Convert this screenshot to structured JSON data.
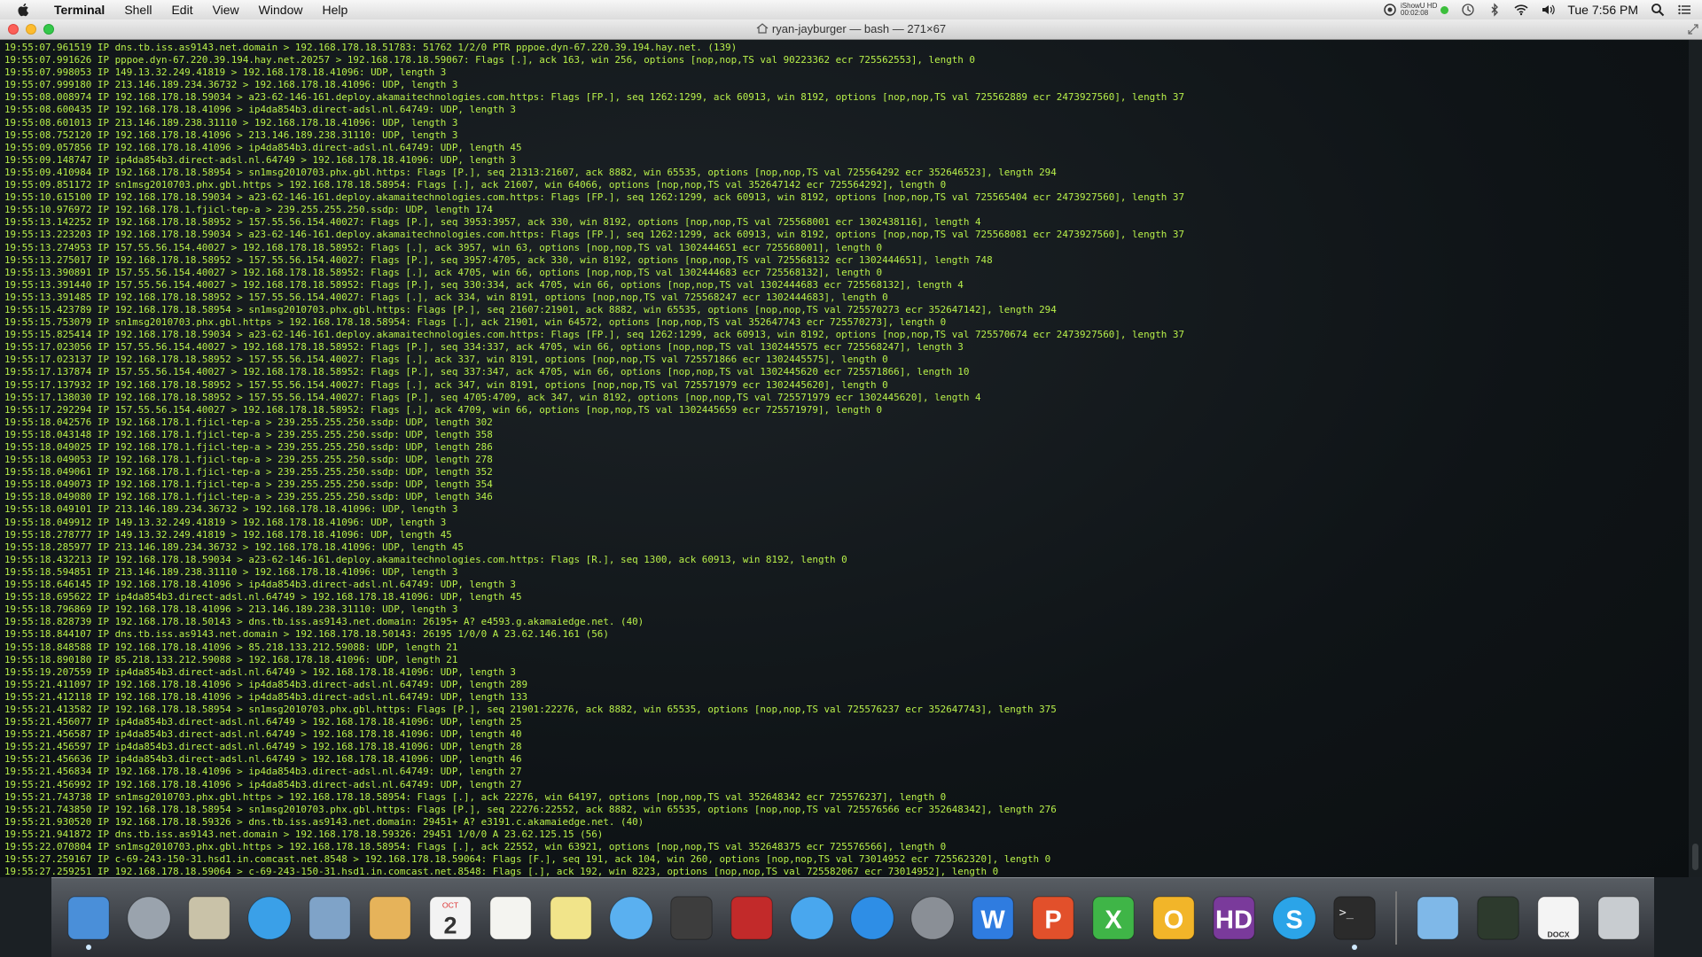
{
  "menubar": {
    "app": "Terminal",
    "items": [
      "Shell",
      "Edit",
      "View",
      "Window",
      "Help"
    ],
    "recorder_label": "iShowU HD",
    "recorder_time": "00:02:08",
    "clock": "Tue 7:56 PM"
  },
  "window": {
    "title": "ryan-jayburger — bash — 271×67"
  },
  "terminal": {
    "text_color": "#b8f04a",
    "lines": [
      "19:55:07.961519 IP dns.tb.iss.as9143.net.domain > 192.168.178.18.51783: 51762 1/2/0 PTR pppoe.dyn-67.220.39.194.hay.net. (139)",
      "19:55:07.991626 IP pppoe.dyn-67.220.39.194.hay.net.20257 > 192.168.178.18.59067: Flags [.], ack 163, win 256, options [nop,nop,TS val 90223362 ecr 725562553], length 0",
      "19:55:07.998053 IP 149.13.32.249.41819 > 192.168.178.18.41096: UDP, length 3",
      "19:55:07.999180 IP 213.146.189.234.36732 > 192.168.178.18.41096: UDP, length 3",
      "19:55:08.008974 IP 192.168.178.18.59034 > a23-62-146-161.deploy.akamaitechnologies.com.https: Flags [FP.], seq 1262:1299, ack 60913, win 8192, options [nop,nop,TS val 725562889 ecr 2473927560], length 37",
      "19:55:08.600435 IP 192.168.178.18.41096 > ip4da854b3.direct-adsl.nl.64749: UDP, length 3",
      "19:55:08.601013 IP 213.146.189.238.31110 > 192.168.178.18.41096: UDP, length 3",
      "19:55:08.752120 IP 192.168.178.18.41096 > 213.146.189.238.31110: UDP, length 3",
      "19:55:09.057856 IP 192.168.178.18.41096 > ip4da854b3.direct-adsl.nl.64749: UDP, length 45",
      "19:55:09.148747 IP ip4da854b3.direct-adsl.nl.64749 > 192.168.178.18.41096: UDP, length 3",
      "19:55:09.410984 IP 192.168.178.18.58954 > sn1msg2010703.phx.gbl.https: Flags [P.], seq 21313:21607, ack 8882, win 65535, options [nop,nop,TS val 725564292 ecr 352646523], length 294",
      "19:55:09.851172 IP sn1msg2010703.phx.gbl.https > 192.168.178.18.58954: Flags [.], ack 21607, win 64066, options [nop,nop,TS val 352647142 ecr 725564292], length 0",
      "19:55:10.615100 IP 192.168.178.18.59034 > a23-62-146-161.deploy.akamaitechnologies.com.https: Flags [FP.], seq 1262:1299, ack 60913, win 8192, options [nop,nop,TS val 725565404 ecr 2473927560], length 37",
      "19:55:10.976972 IP 192.168.178.1.fjicl-tep-a > 239.255.255.250.ssdp: UDP, length 174",
      "19:55:13.142252 IP 192.168.178.18.58952 > 157.55.56.154.40027: Flags [P.], seq 3953:3957, ack 330, win 8192, options [nop,nop,TS val 725568001 ecr 1302438116], length 4",
      "19:55:13.223203 IP 192.168.178.18.59034 > a23-62-146-161.deploy.akamaitechnologies.com.https: Flags [FP.], seq 1262:1299, ack 60913, win 8192, options [nop,nop,TS val 725568081 ecr 2473927560], length 37",
      "19:55:13.274953 IP 157.55.56.154.40027 > 192.168.178.18.58952: Flags [.], ack 3957, win 63, options [nop,nop,TS val 1302444651 ecr 725568001], length 0",
      "19:55:13.275017 IP 192.168.178.18.58952 > 157.55.56.154.40027: Flags [P.], seq 3957:4705, ack 330, win 8192, options [nop,nop,TS val 725568132 ecr 1302444651], length 748",
      "19:55:13.390891 IP 157.55.56.154.40027 > 192.168.178.18.58952: Flags [.], ack 4705, win 66, options [nop,nop,TS val 1302444683 ecr 725568132], length 0",
      "19:55:13.391440 IP 157.55.56.154.40027 > 192.168.178.18.58952: Flags [P.], seq 330:334, ack 4705, win 66, options [nop,nop,TS val 1302444683 ecr 725568132], length 4",
      "19:55:13.391485 IP 192.168.178.18.58952 > 157.55.56.154.40027: Flags [.], ack 334, win 8191, options [nop,nop,TS val 725568247 ecr 1302444683], length 0",
      "19:55:15.423789 IP 192.168.178.18.58954 > sn1msg2010703.phx.gbl.https: Flags [P.], seq 21607:21901, ack 8882, win 65535, options [nop,nop,TS val 725570273 ecr 352647142], length 294",
      "19:55:15.753079 IP sn1msg2010703.phx.gbl.https > 192.168.178.18.58954: Flags [.], ack 21901, win 64572, options [nop,nop,TS val 352647743 ecr 725570273], length 0",
      "19:55:15.825414 IP 192.168.178.18.59034 > a23-62-146-161.deploy.akamaitechnologies.com.https: Flags [FP.], seq 1262:1299, ack 60913, win 8192, options [nop,nop,TS val 725570674 ecr 2473927560], length 37",
      "19:55:17.023056 IP 157.55.56.154.40027 > 192.168.178.18.58952: Flags [P.], seq 334:337, ack 4705, win 66, options [nop,nop,TS val 1302445575 ecr 725568247], length 3",
      "19:55:17.023137 IP 192.168.178.18.58952 > 157.55.56.154.40027: Flags [.], ack 337, win 8191, options [nop,nop,TS val 725571866 ecr 1302445575], length 0",
      "19:55:17.137874 IP 157.55.56.154.40027 > 192.168.178.18.58952: Flags [P.], seq 337:347, ack 4705, win 66, options [nop,nop,TS val 1302445620 ecr 725571866], length 10",
      "19:55:17.137932 IP 192.168.178.18.58952 > 157.55.56.154.40027: Flags [.], ack 347, win 8191, options [nop,nop,TS val 725571979 ecr 1302445620], length 0",
      "19:55:17.138030 IP 192.168.178.18.58952 > 157.55.56.154.40027: Flags [P.], seq 4705:4709, ack 347, win 8192, options [nop,nop,TS val 725571979 ecr 1302445620], length 4",
      "19:55:17.292294 IP 157.55.56.154.40027 > 192.168.178.18.58952: Flags [.], ack 4709, win 66, options [nop,nop,TS val 1302445659 ecr 725571979], length 0",
      "19:55:18.042576 IP 192.168.178.1.fjicl-tep-a > 239.255.255.250.ssdp: UDP, length 302",
      "19:55:18.043148 IP 192.168.178.1.fjicl-tep-a > 239.255.255.250.ssdp: UDP, length 358",
      "19:55:18.049025 IP 192.168.178.1.fjicl-tep-a > 239.255.255.250.ssdp: UDP, length 286",
      "19:55:18.049053 IP 192.168.178.1.fjicl-tep-a > 239.255.255.250.ssdp: UDP, length 278",
      "19:55:18.049061 IP 192.168.178.1.fjicl-tep-a > 239.255.255.250.ssdp: UDP, length 352",
      "19:55:18.049073 IP 192.168.178.1.fjicl-tep-a > 239.255.255.250.ssdp: UDP, length 354",
      "19:55:18.049080 IP 192.168.178.1.fjicl-tep-a > 239.255.255.250.ssdp: UDP, length 346",
      "19:55:18.049101 IP 213.146.189.234.36732 > 192.168.178.18.41096: UDP, length 3",
      "19:55:18.049912 IP 149.13.32.249.41819 > 192.168.178.18.41096: UDP, length 3",
      "19:55:18.278777 IP 149.13.32.249.41819 > 192.168.178.18.41096: UDP, length 45",
      "19:55:18.285977 IP 213.146.189.234.36732 > 192.168.178.18.41096: UDP, length 45",
      "19:55:18.432213 IP 192.168.178.18.59034 > a23-62-146-161.deploy.akamaitechnologies.com.https: Flags [R.], seq 1300, ack 60913, win 8192, length 0",
      "19:55:18.594851 IP 213.146.189.238.31110 > 192.168.178.18.41096: UDP, length 3",
      "19:55:18.646145 IP 192.168.178.18.41096 > ip4da854b3.direct-adsl.nl.64749: UDP, length 3",
      "19:55:18.695622 IP ip4da854b3.direct-adsl.nl.64749 > 192.168.178.18.41096: UDP, length 45",
      "19:55:18.796869 IP 192.168.178.18.41096 > 213.146.189.238.31110: UDP, length 3",
      "19:55:18.828739 IP 192.168.178.18.50143 > dns.tb.iss.as9143.net.domain: 26195+ A? e4593.g.akamaiedge.net. (40)",
      "19:55:18.844107 IP dns.tb.iss.as9143.net.domain > 192.168.178.18.50143: 26195 1/0/0 A 23.62.146.161 (56)",
      "19:55:18.848588 IP 192.168.178.18.41096 > 85.218.133.212.59088: UDP, length 21",
      "19:55:18.890180 IP 85.218.133.212.59088 > 192.168.178.18.41096: UDP, length 21",
      "19:55:19.207559 IP ip4da854b3.direct-adsl.nl.64749 > 192.168.178.18.41096: UDP, length 3",
      "19:55:21.411097 IP 192.168.178.18.41096 > ip4da854b3.direct-adsl.nl.64749: UDP, length 289",
      "19:55:21.412118 IP 192.168.178.18.41096 > ip4da854b3.direct-adsl.nl.64749: UDP, length 133",
      "19:55:21.413582 IP 192.168.178.18.58954 > sn1msg2010703.phx.gbl.https: Flags [P.], seq 21901:22276, ack 8882, win 65535, options [nop,nop,TS val 725576237 ecr 352647743], length 375",
      "19:55:21.456077 IP ip4da854b3.direct-adsl.nl.64749 > 192.168.178.18.41096: UDP, length 25",
      "19:55:21.456587 IP ip4da854b3.direct-adsl.nl.64749 > 192.168.178.18.41096: UDP, length 40",
      "19:55:21.456597 IP ip4da854b3.direct-adsl.nl.64749 > 192.168.178.18.41096: UDP, length 28",
      "19:55:21.456636 IP ip4da854b3.direct-adsl.nl.64749 > 192.168.178.18.41096: UDP, length 46",
      "19:55:21.456834 IP 192.168.178.18.41096 > ip4da854b3.direct-adsl.nl.64749: UDP, length 27",
      "19:55:21.456992 IP 192.168.178.18.41096 > ip4da854b3.direct-adsl.nl.64749: UDP, length 27",
      "19:55:21.743738 IP sn1msg2010703.phx.gbl.https > 192.168.178.18.58954: Flags [.], ack 22276, win 64197, options [nop,nop,TS val 352648342 ecr 725576237], length 0",
      "19:55:21.743850 IP 192.168.178.18.58954 > sn1msg2010703.phx.gbl.https: Flags [P.], seq 22276:22552, ack 8882, win 65535, options [nop,nop,TS val 725576566 ecr 352648342], length 276",
      "19:55:21.930520 IP 192.168.178.18.59326 > dns.tb.iss.as9143.net.domain: 29451+ A? e3191.c.akamaiedge.net. (40)",
      "19:55:21.941872 IP dns.tb.iss.as9143.net.domain > 192.168.178.18.59326: 29451 1/0/0 A 23.62.125.15 (56)",
      "19:55:22.070804 IP sn1msg2010703.phx.gbl.https > 192.168.178.18.58954: Flags [.], ack 22552, win 63921, options [nop,nop,TS val 352648375 ecr 725576566], length 0",
      "19:55:27.259167 IP c-69-243-150-31.hsd1.in.comcast.net.8548 > 192.168.178.18.59064: Flags [F.], seq 191, ack 104, win 260, options [nop,nop,TS val 73014952 ecr 725562320], length 0",
      "19:55:27.259251 IP 192.168.178.18.59064 > c-69-243-150-31.hsd1.in.comcast.net.8548: Flags [.], ack 192, win 8223, options [nop,nop,TS val 725582067 ecr 73014952], length 0"
    ]
  },
  "dock": {
    "items": [
      {
        "name": "finder-icon",
        "color": "#4a8fd9"
      },
      {
        "name": "launchpad-icon",
        "color": "#9aa3ad"
      },
      {
        "name": "preview-icon",
        "color": "#c9c2a8"
      },
      {
        "name": "safari-icon",
        "color": "#3aa0e8"
      },
      {
        "name": "mail-icon",
        "color": "#7fa3c8"
      },
      {
        "name": "contacts-icon",
        "color": "#e6b35a"
      },
      {
        "name": "calendar-icon",
        "color": "#f3f3f3",
        "text": "2",
        "month": "OCT"
      },
      {
        "name": "reminders-icon",
        "color": "#f4f4f0"
      },
      {
        "name": "notes-icon",
        "color": "#f1e48a"
      },
      {
        "name": "messages-icon",
        "color": "#5ab0f0"
      },
      {
        "name": "facetime-icon",
        "color": "#3d3d3d"
      },
      {
        "name": "photo-booth-icon",
        "color": "#c22a2a"
      },
      {
        "name": "itunes-icon",
        "color": "#49a7ee"
      },
      {
        "name": "app-store-icon",
        "color": "#2e8ee6"
      },
      {
        "name": "system-preferences-icon",
        "color": "#8a8f96"
      },
      {
        "name": "word-icon",
        "color": "#2f7ce0",
        "text": "W"
      },
      {
        "name": "powerpoint-icon",
        "color": "#e2502b",
        "text": "P"
      },
      {
        "name": "excel-icon",
        "color": "#3fb547",
        "text": "X"
      },
      {
        "name": "outlook-icon",
        "color": "#f2b529",
        "text": "O"
      },
      {
        "name": "hd-video-icon",
        "color": "#7a3a9b",
        "text": "HD"
      },
      {
        "name": "skype-icon",
        "color": "#2ba4e8",
        "text": "S"
      },
      {
        "name": "terminal-icon",
        "color": "#2b2b2b"
      },
      {
        "name": "folder-icon",
        "color": "#7fb8e8"
      },
      {
        "name": "activity-monitor-icon",
        "color": "#2d3a2d"
      },
      {
        "name": "docx-document-icon",
        "color": "#f4f4f4",
        "text": "DOCX"
      },
      {
        "name": "trash-icon",
        "color": "#c8ccd0"
      }
    ]
  }
}
